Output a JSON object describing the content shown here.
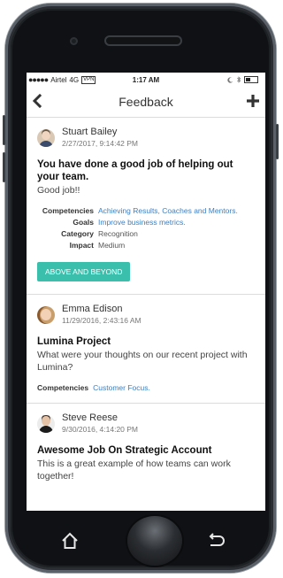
{
  "status_bar": {
    "signal": "●●●●●",
    "carrier": "Airtel",
    "network": "4G",
    "vpn": "VPN",
    "time": "1:17 AM"
  },
  "navbar": {
    "back_icon": "chevron-left-icon",
    "title": "Feedback",
    "add_icon": "plus-icon"
  },
  "feed": [
    {
      "author": "Stuart Bailey",
      "date": "2/27/2017, 9:14:42 PM",
      "headline": "You have done a good job of helping out your team.",
      "body": "Good job!!",
      "meta": [
        {
          "label": "Competencies",
          "value": "Achieving Results, Coaches and Mentors."
        },
        {
          "label": "Goals",
          "value": "Improve business metrics."
        },
        {
          "label": "Category",
          "value": "Recognition"
        },
        {
          "label": "Impact",
          "value": "Medium"
        }
      ],
      "badge": "ABOVE AND BEYOND"
    },
    {
      "author": "Emma Edison",
      "date": "11/29/2016, 2:43:16 AM",
      "headline": "Lumina Project",
      "body": "What were your thoughts on our recent project with Lumina?",
      "meta": [
        {
          "label": "Competencies",
          "value": "Customer Focus."
        }
      ]
    },
    {
      "author": "Steve Reese",
      "date": "9/30/2016, 4:14:20 PM",
      "headline": "Awesome Job On Strategic Account",
      "body": "This is a great example of how teams can work together!"
    }
  ],
  "colors": {
    "accent": "#3bbfad",
    "link": "#3b7fc4",
    "phone_body": "#2a2d31"
  }
}
